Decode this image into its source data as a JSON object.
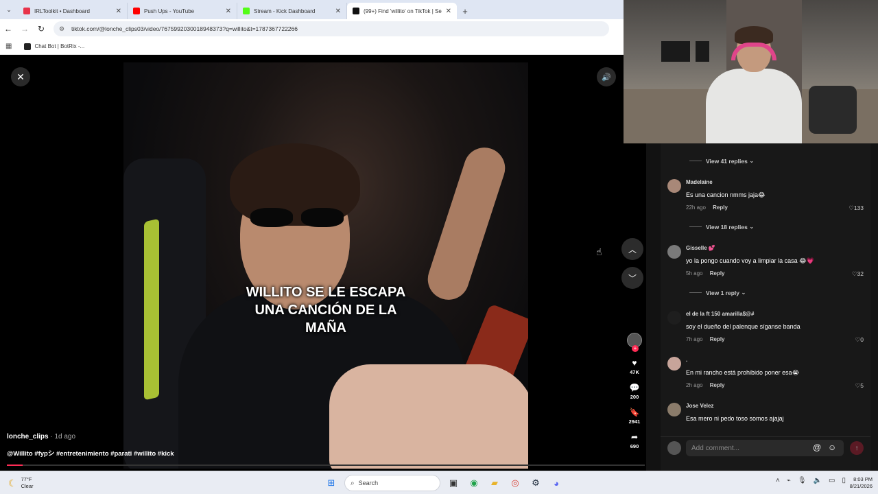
{
  "browser": {
    "tabs": [
      {
        "title": "IRLToolkit • Dashboard",
        "favicon_color": "#e8334a",
        "active": false
      },
      {
        "title": "Push Ups - YouTube",
        "favicon_color": "#ff0000",
        "active": false
      },
      {
        "title": "Stream - Kick Dashboard",
        "favicon_color": "#53fc18",
        "active": false
      },
      {
        "title": "(99+) Find 'willito' on TikTok | Se",
        "favicon_color": "#111111",
        "active": true
      }
    ],
    "url": "tiktok.com/@lonche_clips03/video/7675992030018948373?q=willito&t=1787367722266",
    "bookmark": "Chat Bot | BotRix -..."
  },
  "video": {
    "caption_lines": [
      "WILLITO SE LE ESCAPA",
      "UNA CANCIÓN DE LA",
      "MAÑA"
    ],
    "author": "lonche_clips",
    "age": "· 1d ago",
    "description": "@Willito #fypシ #entretenimiento #parati #willito #kick",
    "progress_fraction": 0.025,
    "actions": {
      "likes": "47K",
      "comments": "200",
      "saves": "2941",
      "shares": "690"
    }
  },
  "comments": {
    "thread_toggles": [
      "View 41 replies",
      "View 18 replies",
      "View 1 reply"
    ],
    "items": [
      {
        "user": "Madelaine",
        "text": "Es una cancion nmms jaja😂",
        "time": "22h ago",
        "reply": "Reply",
        "likes": "133"
      },
      {
        "user": "Gisselle 💕",
        "text": "yo la pongo cuando voy a limpiar la casa 😂💗",
        "time": "5h ago",
        "reply": "Reply",
        "likes": "32"
      },
      {
        "user": "el de la ft 150 amarilla$@#",
        "text": "soy el dueño del palenque síganse banda",
        "time": "7h ago",
        "reply": "Reply",
        "likes": "0"
      },
      {
        "user": ".",
        "text": "En mi rancho está prohibido poner esa😭",
        "time": "2h ago",
        "reply": "Reply",
        "likes": "5"
      },
      {
        "user": "Jose Velez",
        "text": "Esa mero ni pedo toso somos ajajaj",
        "time": "",
        "reply": "",
        "likes": ""
      }
    ],
    "add_placeholder": "Add comment..."
  },
  "taskbar": {
    "temp": "77°F",
    "condition": "Clear",
    "search": "Search",
    "time": "8:03 PM",
    "date": "8/21/2026"
  },
  "colors": {
    "tiktok_red": "#fe2c55",
    "background": "#121212"
  }
}
